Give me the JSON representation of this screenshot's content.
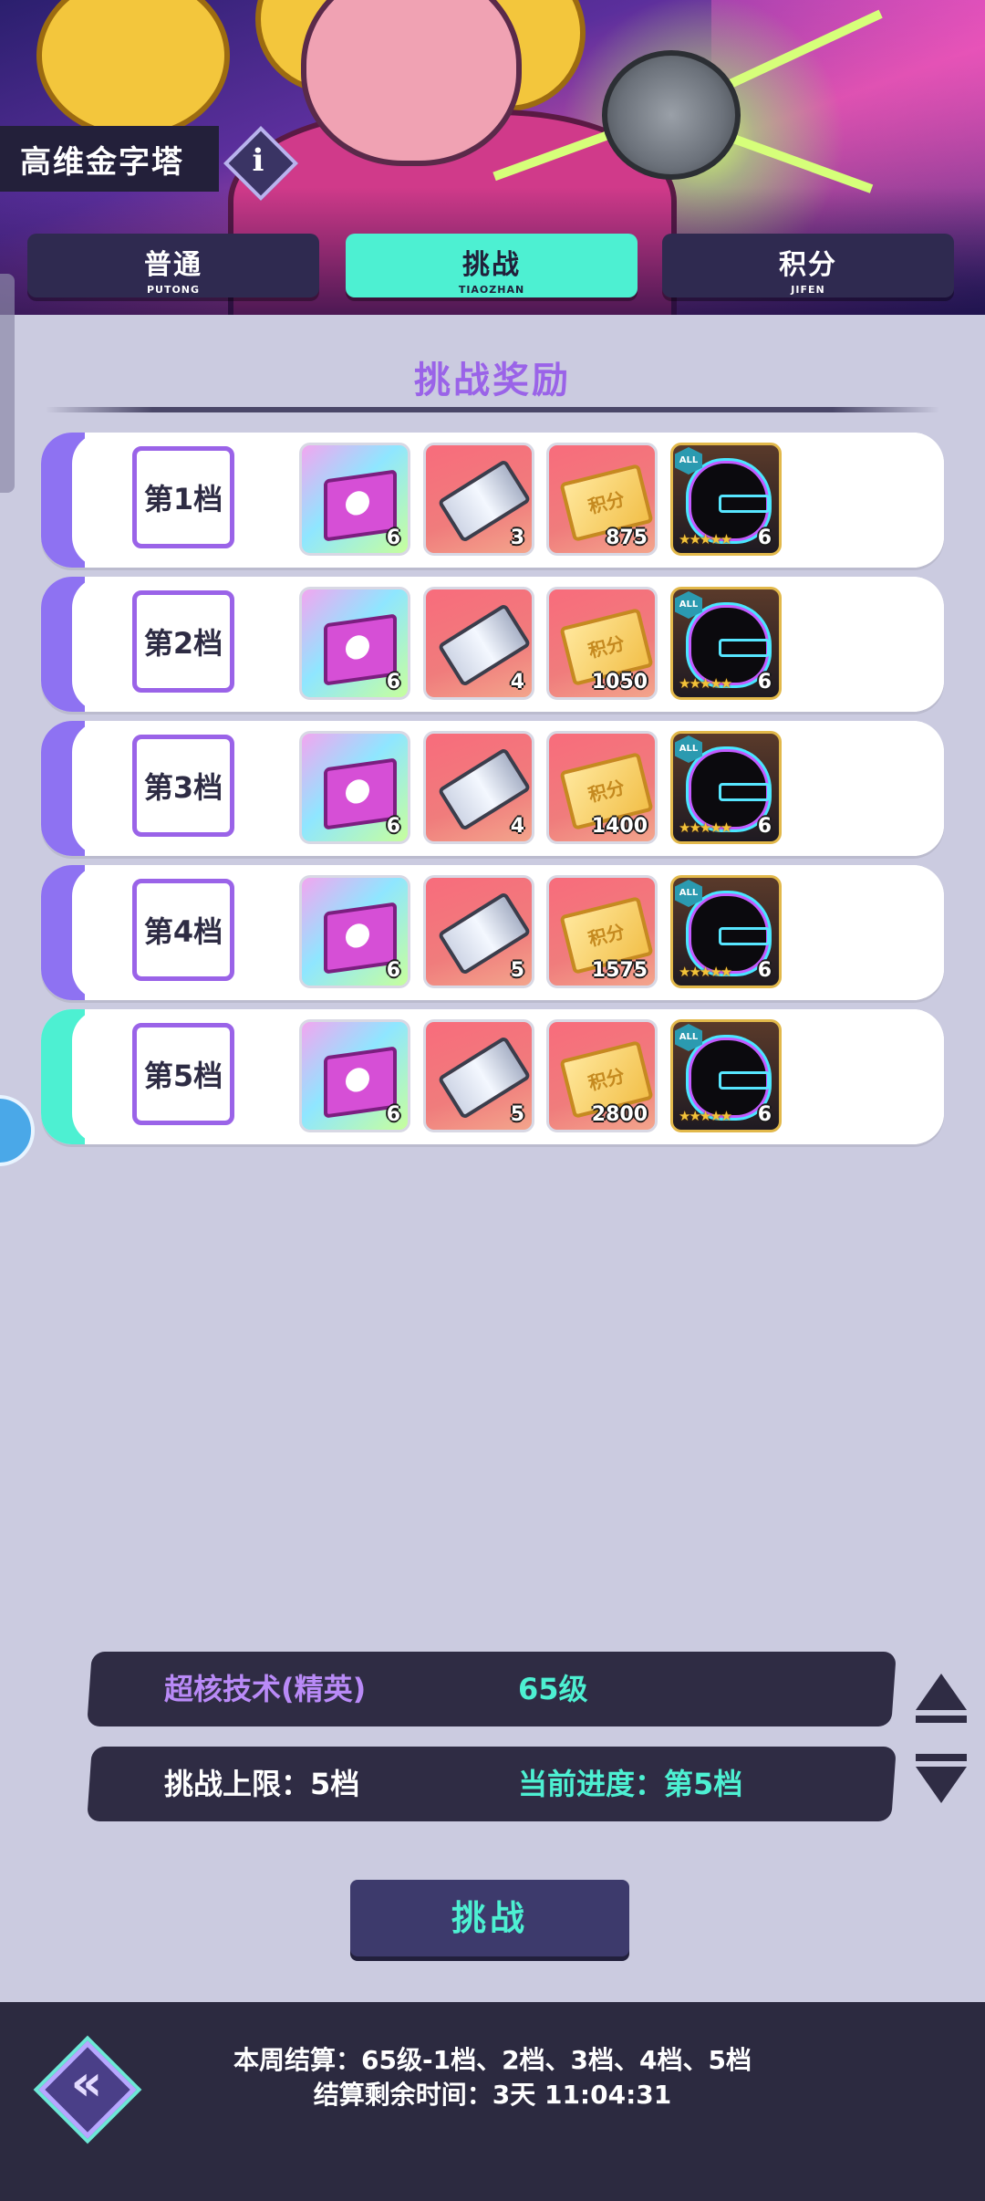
{
  "header": {
    "title": "高维金字塔",
    "info_glyph": "i"
  },
  "tabs": [
    {
      "label": "普通",
      "pinyin": "PUTONG",
      "active": false
    },
    {
      "label": "挑战",
      "pinyin": "TIAOZHAN",
      "active": true
    },
    {
      "label": "积分",
      "pinyin": "JIFEN",
      "active": false
    }
  ],
  "rewards": {
    "title": "挑战奖励",
    "point_ticket_text": "积分",
    "hero_badge": "ALL",
    "hero_stars": "★★★★★",
    "tiers": [
      {
        "label": "第1档",
        "items": [
          {
            "type": "gift-box",
            "qty": "6"
          },
          {
            "type": "card-ticket",
            "qty": "3"
          },
          {
            "type": "points-ticket",
            "qty": "875"
          },
          {
            "type": "hero-shard",
            "qty": "6"
          }
        ]
      },
      {
        "label": "第2档",
        "items": [
          {
            "type": "gift-box",
            "qty": "6"
          },
          {
            "type": "card-ticket",
            "qty": "4"
          },
          {
            "type": "points-ticket",
            "qty": "1050"
          },
          {
            "type": "hero-shard",
            "qty": "6"
          }
        ]
      },
      {
        "label": "第3档",
        "items": [
          {
            "type": "gift-box",
            "qty": "6"
          },
          {
            "type": "card-ticket",
            "qty": "4"
          },
          {
            "type": "points-ticket",
            "qty": "1400"
          },
          {
            "type": "hero-shard",
            "qty": "6"
          }
        ]
      },
      {
        "label": "第4档",
        "items": [
          {
            "type": "gift-box",
            "qty": "6"
          },
          {
            "type": "card-ticket",
            "qty": "5"
          },
          {
            "type": "points-ticket",
            "qty": "1575"
          },
          {
            "type": "hero-shard",
            "qty": "6"
          }
        ]
      },
      {
        "label": "第5档",
        "items": [
          {
            "type": "gift-box",
            "qty": "6"
          },
          {
            "type": "card-ticket",
            "qty": "5"
          },
          {
            "type": "points-ticket",
            "qty": "2800"
          },
          {
            "type": "hero-shard",
            "qty": "6"
          }
        ]
      }
    ],
    "current_tier_index": 4
  },
  "difficulty": {
    "name": "超核技术(精英)",
    "level": "65级",
    "limit": "挑战上限：5档",
    "progress": "当前进度：第5档"
  },
  "challenge_button": "挑战",
  "footer": {
    "back_glyph": "«",
    "settlement": "本周结算：65级-1档、2档、3档、4档、5档",
    "time_left": "结算剩余时间：3天 11:04:31"
  },
  "colors": {
    "accent_teal": "#4df0d2",
    "accent_purple": "#9a63e8",
    "panel_dark": "#2f2c44",
    "background": "#cbcbe0"
  }
}
